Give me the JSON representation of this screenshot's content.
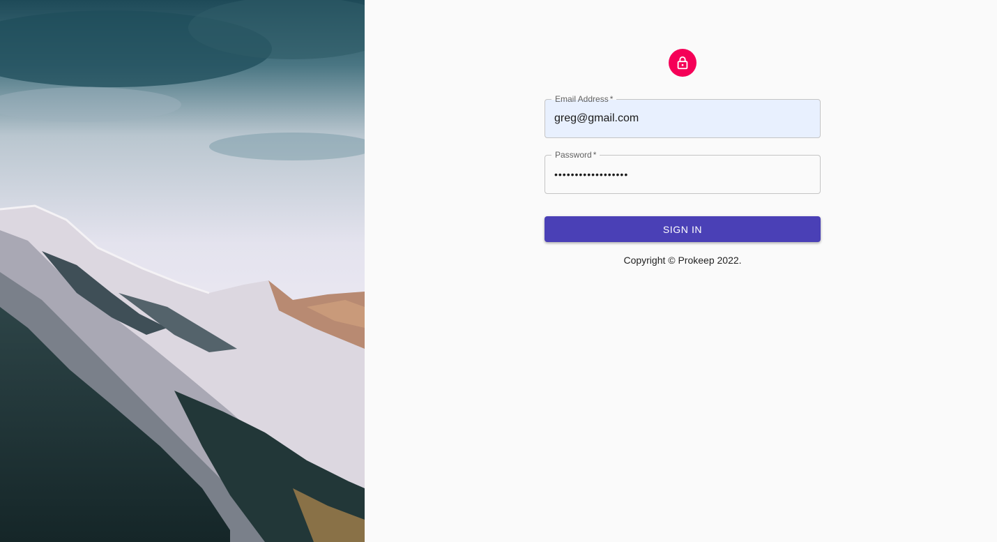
{
  "colors": {
    "page_background": "#fafafa",
    "lock_avatar": "#f50057",
    "sign_in_button": "#4a40b6",
    "email_autofill_fill": "#e8f0fe"
  },
  "hero": {
    "image": "snowy mountain peak under cloudy sky"
  },
  "form": {
    "lock_icon": "lock-icon",
    "email": {
      "label": "Email Address",
      "required_mark": "*",
      "value": "greg@gmail.com"
    },
    "password": {
      "label": "Password",
      "required_mark": "*",
      "value": "••••••••••••••••••"
    },
    "submit_label": "Sign In"
  },
  "footer": {
    "copyright": "Copyright © Prokeep 2022."
  }
}
